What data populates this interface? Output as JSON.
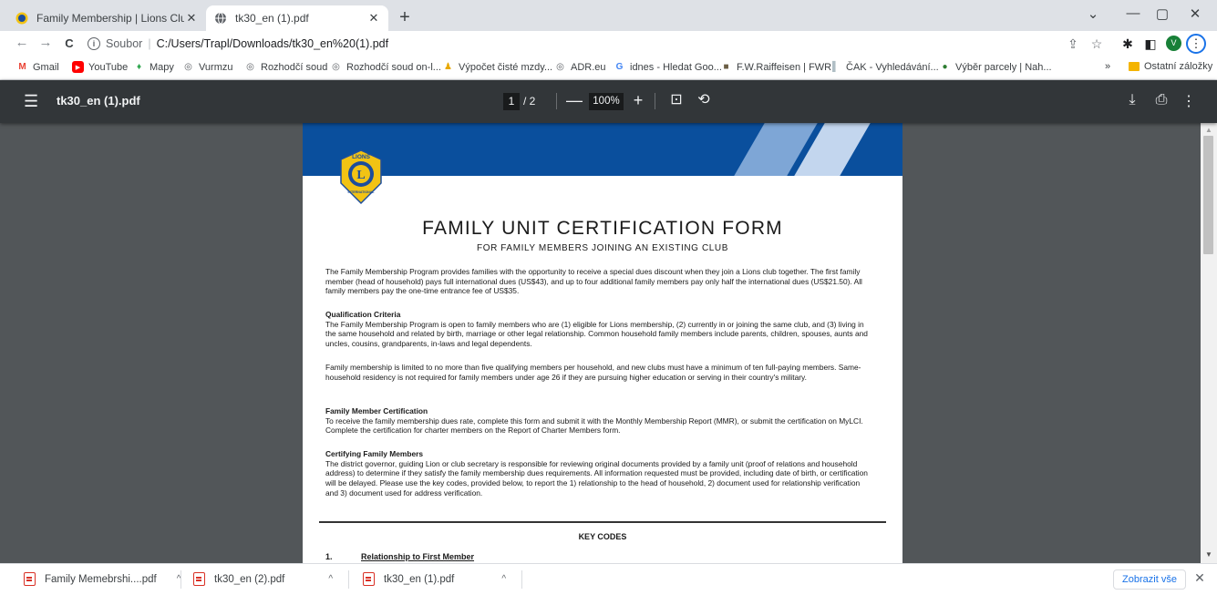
{
  "browser": {
    "tabs": [
      {
        "title": "Family Membership | Lions Clubs",
        "close": "✕",
        "icon": "lions-favicon"
      },
      {
        "title": "tk30_en (1).pdf",
        "close": "✕",
        "icon": "globe-icon"
      }
    ],
    "new_tab": "+",
    "window_controls": {
      "dropdown": "⌄",
      "minimize": "—",
      "maximize": "▢",
      "close": "✕"
    },
    "nav": {
      "back": "←",
      "forward": "→",
      "reload": "C"
    },
    "address": {
      "info": "i",
      "prefix": "Soubor",
      "separator": "|",
      "url": "C:/Users/Trapl/Downloads/tk30_en%20(1).pdf"
    },
    "toolbar_icons": {
      "share": "⇪",
      "star": "☆",
      "extensions": "✱",
      "sidepanel": "◧",
      "avatar": "V",
      "menu": "⋮"
    },
    "bookmarks": [
      {
        "label": "Gmail",
        "icon": "gmail-icon",
        "glyph": "M",
        "color": "#ea4335"
      },
      {
        "label": "YouTube",
        "icon": "youtube-icon",
        "glyph": "▶",
        "color": "#ff0000"
      },
      {
        "label": "Mapy",
        "icon": "maps-pin-icon",
        "glyph": "♦",
        "color": "#34a853"
      },
      {
        "label": "Vurmzu",
        "icon": "globe-icon",
        "glyph": "◎",
        "color": "#5f6368"
      },
      {
        "label": "Rozhodčí soud",
        "icon": "globe-icon",
        "glyph": "◎",
        "color": "#5f6368"
      },
      {
        "label": "Rozhodčí soud on-l...",
        "icon": "globe-icon",
        "glyph": "◎",
        "color": "#5f6368"
      },
      {
        "label": "Výpočet čisté mzdy...",
        "icon": "figure-icon",
        "glyph": "♟",
        "color": "#e8a800"
      },
      {
        "label": "ADR.eu",
        "icon": "globe-icon",
        "glyph": "◎",
        "color": "#5f6368"
      },
      {
        "label": "idnes - Hledat Goo...",
        "icon": "google-icon",
        "glyph": "G",
        "color": "#4285f4"
      },
      {
        "label": "F.W.Raiffeisen | FWR",
        "icon": "fwr-icon",
        "glyph": "■",
        "color": "#6b5e45"
      },
      {
        "label": "ČAK - Vyhledávání...",
        "icon": "cak-icon",
        "glyph": "▌",
        "color": "#b0bec5"
      },
      {
        "label": "Výběr parcely | Nah...",
        "icon": "parcel-icon",
        "glyph": "●",
        "color": "#2e7d32"
      }
    ],
    "bookmarks_more": "»",
    "other_bookmarks": "Ostatní záložky"
  },
  "pdf_viewer": {
    "menu_icon": "☰",
    "file_name": "tk30_en (1).pdf",
    "page_current": "1",
    "page_total": "/ 2",
    "zoom_out": "—",
    "zoom": "100%",
    "zoom_in": "+",
    "fit_icon": "⊡",
    "rotate_icon": "⟲",
    "download_icon": "⤓",
    "print_icon": "⎙",
    "more_icon": "⋮"
  },
  "document": {
    "title": "FAMILY UNIT CERTIFICATION FORM",
    "subtitle": "FOR FAMILY MEMBERS JOINING AN EXISTING CLUB",
    "intro": "The Family Membership Program provides families with the opportunity to receive a special dues discount when they join a Lions club together. The first family member (head of household) pays full international dues (US$43), and up to four additional family members pay only half the international dues (US$21.50). All family members pay the one-time entrance fee of US$35.",
    "qualification_heading": "Qualification Criteria",
    "qualification_text": "The Family Membership Program is open to family members who are (1) eligible for Lions membership, (2) currently in or joining the same club, and (3) living in the same household and related by birth, marriage or other legal relationship. Common household family members include parents, children, spouses, aunts and uncles, cousins, grandparents, in-laws and legal dependents.",
    "limit_text": "Family membership is limited to no more than five qualifying members per household, and new clubs must have a minimum of ten full-paying members. Same-household residency is not required for family members under age 26 if they are pursuing higher education or serving in their country's military.",
    "certification_heading": "Family Member Certification",
    "certification_text": "To receive the family membership dues rate, complete this form and submit it with the Monthly Membership Report (MMR), or submit the certification on MyLCI.  Complete the certification for charter members on the Report of Charter Members form.",
    "certifying_heading": "Certifying Family Members",
    "certifying_text": "The district governor, guiding Lion or club secretary is responsible for reviewing original documents provided by a family unit (proof of relations and household address) to determine if they satisfy the family membership dues requirements. All information requested must be provided, including date of birth, or certification will be delayed. Please use the key codes, provided below, to report the 1) relationship to the head of household, 2) document used for relationship verification and 3) document used for address verification.",
    "key_codes_heading": "KEY CODES",
    "key_code_1_number": "1.",
    "key_code_1_title": "Relationship to First Member",
    "logo_text_top": "LIONS",
    "logo_text_bottom": "INTERNATIONAL",
    "logo_letter": "L"
  },
  "scrollbar": {
    "up": "▲",
    "down": "▼"
  },
  "downloads": {
    "items": [
      {
        "name": "Family Memebrshi....pdf",
        "chevron": "^"
      },
      {
        "name": "tk30_en (2).pdf",
        "chevron": "^"
      },
      {
        "name": "tk30_en (1).pdf",
        "chevron": "^"
      }
    ],
    "show_all": "Zobrazit vše",
    "close": "✕"
  },
  "colors": {
    "pdf_toolbar": "#323639",
    "viewer_bg": "#525659",
    "banner_blue": "#0a4f9d",
    "lions_gold": "#f2c314",
    "lions_blue": "#1c4d9c",
    "link_blue": "#1a73e8"
  }
}
